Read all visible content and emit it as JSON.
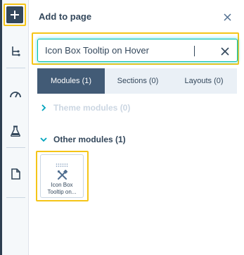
{
  "sidebar": {
    "add_button": {
      "icon": "plus-icon"
    },
    "items": [
      {
        "icon": "tree-structure-icon"
      },
      {
        "icon": "speedometer-icon"
      },
      {
        "icon": "flask-icon"
      },
      {
        "icon": "document-icon"
      }
    ]
  },
  "panel": {
    "title": "Add to page",
    "close_icon": "close-icon"
  },
  "search": {
    "value": "Icon Box Tooltip on Hover",
    "clear_icon": "clear-icon"
  },
  "tabs": [
    {
      "label": "Modules (1)",
      "active": true
    },
    {
      "label": "Sections (0)",
      "active": false
    },
    {
      "label": "Layouts (0)",
      "active": false
    }
  ],
  "sections": [
    {
      "label": "Theme modules (0)",
      "expanded": false
    },
    {
      "label": "Other modules (1)",
      "expanded": true
    }
  ],
  "modules": [
    {
      "label_line1": "Icon Box",
      "label_line2": "Tooltip on...",
      "icon": "tools-icon"
    }
  ],
  "colors": {
    "highlight": "#f5c518",
    "active_tab": "#425b76",
    "focus_border": "#00bda5",
    "text": "#33475b"
  }
}
